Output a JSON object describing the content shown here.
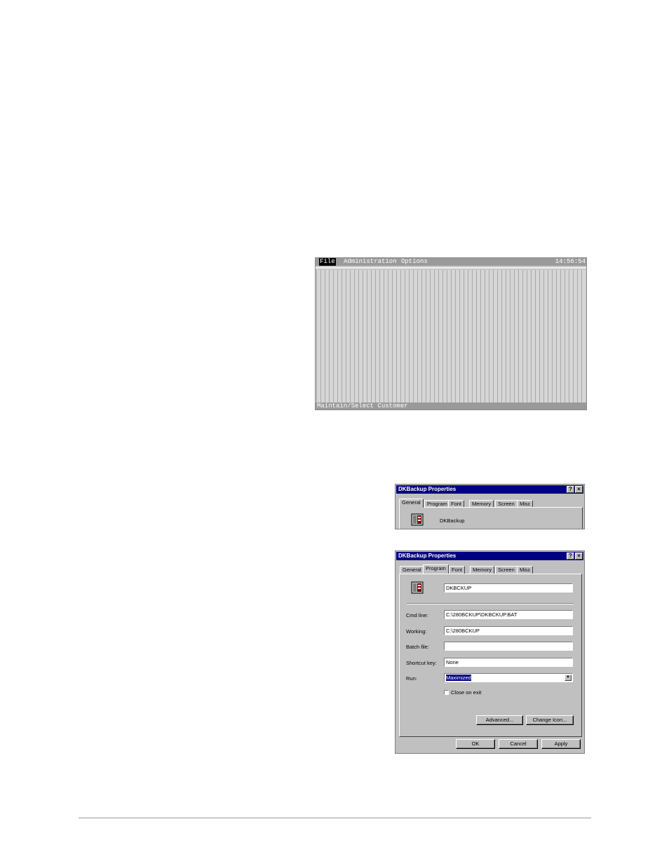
{
  "dos_screen": {
    "menu": [
      "File",
      "Administration",
      "Options"
    ],
    "clock": "14:56:54",
    "status": "Maintain/Select Customer"
  },
  "dialog_small": {
    "title": "DKBackup Properties",
    "help_button": "?",
    "close_button": "×",
    "tabs": [
      "General",
      "Program",
      "Font",
      "Memory",
      "Screen",
      "Misc"
    ],
    "active_tab": "General",
    "program_name": "DKBackup"
  },
  "dialog_large": {
    "title": "DKBackup Properties",
    "help_button": "?",
    "close_button": "×",
    "tabs": [
      "General",
      "Program",
      "Font",
      "Memory",
      "Screen",
      "Misc"
    ],
    "active_tab": "Program",
    "name_value": "DKBCKUP",
    "cmd_line_label": "Cmd line:",
    "cmd_line_value": "C:\\280BCKUP\\DKBCKUP.BAT",
    "working_label": "Working:",
    "working_value": "C:\\280BCKUP",
    "batch_file_label": "Batch file:",
    "batch_file_value": "",
    "shortcut_key_label": "Shortcut key:",
    "shortcut_key_value": "None",
    "run_label": "Run:",
    "run_value": "Maximized",
    "close_on_exit_label": "Close on exit",
    "close_on_exit_checked": false,
    "advanced_button": "Advanced...",
    "change_icon_button": "Change Icon...",
    "ok_button": "OK",
    "cancel_button": "Cancel",
    "apply_button": "Apply"
  }
}
